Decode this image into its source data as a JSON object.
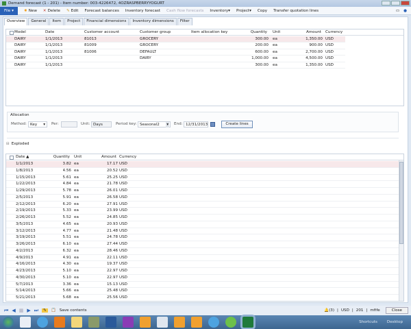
{
  "window": {
    "title": "Demand forecast (1 - 201) - Item number: 003-4226472, 4OZRASPBERRYYOGURT"
  },
  "menu": {
    "file": "File",
    "items": [
      {
        "label": "New",
        "icon": "new-icon",
        "disabled": false
      },
      {
        "label": "Delete",
        "icon": "delete-icon",
        "disabled": false
      },
      {
        "label": "Edit",
        "icon": "edit-icon",
        "disabled": false
      },
      {
        "label": "Forecast balances",
        "disabled": false
      },
      {
        "label": "Inventory forecast",
        "disabled": false
      },
      {
        "label": "Cash flow forecasts",
        "disabled": true
      },
      {
        "label": "Inventory▾",
        "disabled": false
      },
      {
        "label": "Project▾",
        "disabled": false
      },
      {
        "label": "Copy",
        "disabled": false
      },
      {
        "label": "Transfer quotation lines",
        "disabled": false
      }
    ]
  },
  "tabs": [
    "Overview",
    "General",
    "Item",
    "Project",
    "Financial dimensions",
    "Inventory dimensions",
    "Filter"
  ],
  "upper_grid": {
    "headers": [
      "Model",
      "Date",
      "Customer account",
      "Customer group",
      "Item allocation key",
      "Quantity",
      "Unit",
      "Amount",
      "Currency"
    ],
    "rows": [
      [
        "DAIRY",
        "1/1/2013",
        "81013",
        "GROCERY",
        "",
        "300.00",
        "ea",
        "1,350.00",
        "USD"
      ],
      [
        "DAIRY",
        "1/1/2013",
        "81009",
        "GROCERY",
        "",
        "200.00",
        "ea",
        "900.00",
        "USD"
      ],
      [
        "DAIRY",
        "1/1/2013",
        "81006",
        "DEFAULT",
        "",
        "600.00",
        "ea",
        "2,700.00",
        "USD"
      ],
      [
        "DAIRY",
        "1/1/2013",
        "",
        "DAIRY",
        "",
        "1,000.00",
        "ea",
        "4,500.00",
        "USD"
      ],
      [
        "DAIRY",
        "1/1/2013",
        "",
        "",
        "",
        "300.00",
        "ea",
        "1,350.00",
        "USD"
      ]
    ]
  },
  "allocation": {
    "title": "Allocation",
    "method_label": "Method:",
    "method": "Key",
    "per_label": "Per:",
    "per": "",
    "unit_label": "Unit:",
    "unit": "Days",
    "period_key_label": "Period key:",
    "period_key": "Seasonal2",
    "end_label": "End:",
    "end": "12/31/2013",
    "create_lines": "Create lines"
  },
  "exploded": {
    "title": "Exploded",
    "headers": [
      "Date ▲",
      "Quantity",
      "Unit",
      "Amount",
      "Currency"
    ],
    "rows": [
      [
        "1/1/2013",
        "3.82",
        "ea",
        "17.17",
        "USD"
      ],
      [
        "1/8/2013",
        "4.56",
        "ea",
        "20.52",
        "USD"
      ],
      [
        "1/15/2013",
        "5.61",
        "ea",
        "25.25",
        "USD"
      ],
      [
        "1/22/2013",
        "4.84",
        "ea",
        "21.78",
        "USD"
      ],
      [
        "1/29/2013",
        "5.78",
        "ea",
        "26.01",
        "USD"
      ],
      [
        "2/5/2013",
        "5.91",
        "ea",
        "26.58",
        "USD"
      ],
      [
        "2/12/2013",
        "6.20",
        "ea",
        "27.91",
        "USD"
      ],
      [
        "2/19/2013",
        "5.33",
        "ea",
        "23.99",
        "USD"
      ],
      [
        "2/26/2013",
        "5.52",
        "ea",
        "24.85",
        "USD"
      ],
      [
        "3/5/2013",
        "4.65",
        "ea",
        "20.93",
        "USD"
      ],
      [
        "3/12/2013",
        "4.77",
        "ea",
        "21.48",
        "USD"
      ],
      [
        "3/19/2013",
        "5.51",
        "ea",
        "24.78",
        "USD"
      ],
      [
        "3/26/2013",
        "6.10",
        "ea",
        "27.44",
        "USD"
      ],
      [
        "4/2/2013",
        "6.32",
        "ea",
        "28.46",
        "USD"
      ],
      [
        "4/9/2013",
        "4.91",
        "ea",
        "22.11",
        "USD"
      ],
      [
        "4/16/2013",
        "4.30",
        "ea",
        "19.37",
        "USD"
      ],
      [
        "4/23/2013",
        "5.10",
        "ea",
        "22.97",
        "USD"
      ],
      [
        "4/30/2013",
        "5.10",
        "ea",
        "22.97",
        "USD"
      ],
      [
        "5/7/2013",
        "3.36",
        "ea",
        "15.13",
        "USD"
      ],
      [
        "5/14/2013",
        "5.66",
        "ea",
        "25.48",
        "USD"
      ],
      [
        "5/21/2013",
        "5.68",
        "ea",
        "25.56",
        "USD"
      ]
    ]
  },
  "status": {
    "save_contents": "Save contents",
    "alerts": "(3)",
    "currency": "USD",
    "company": "201",
    "user": "mfife",
    "close": "Close"
  },
  "taskbar": {
    "shortcuts": "Shortcuts",
    "desktop": "Desktop"
  }
}
